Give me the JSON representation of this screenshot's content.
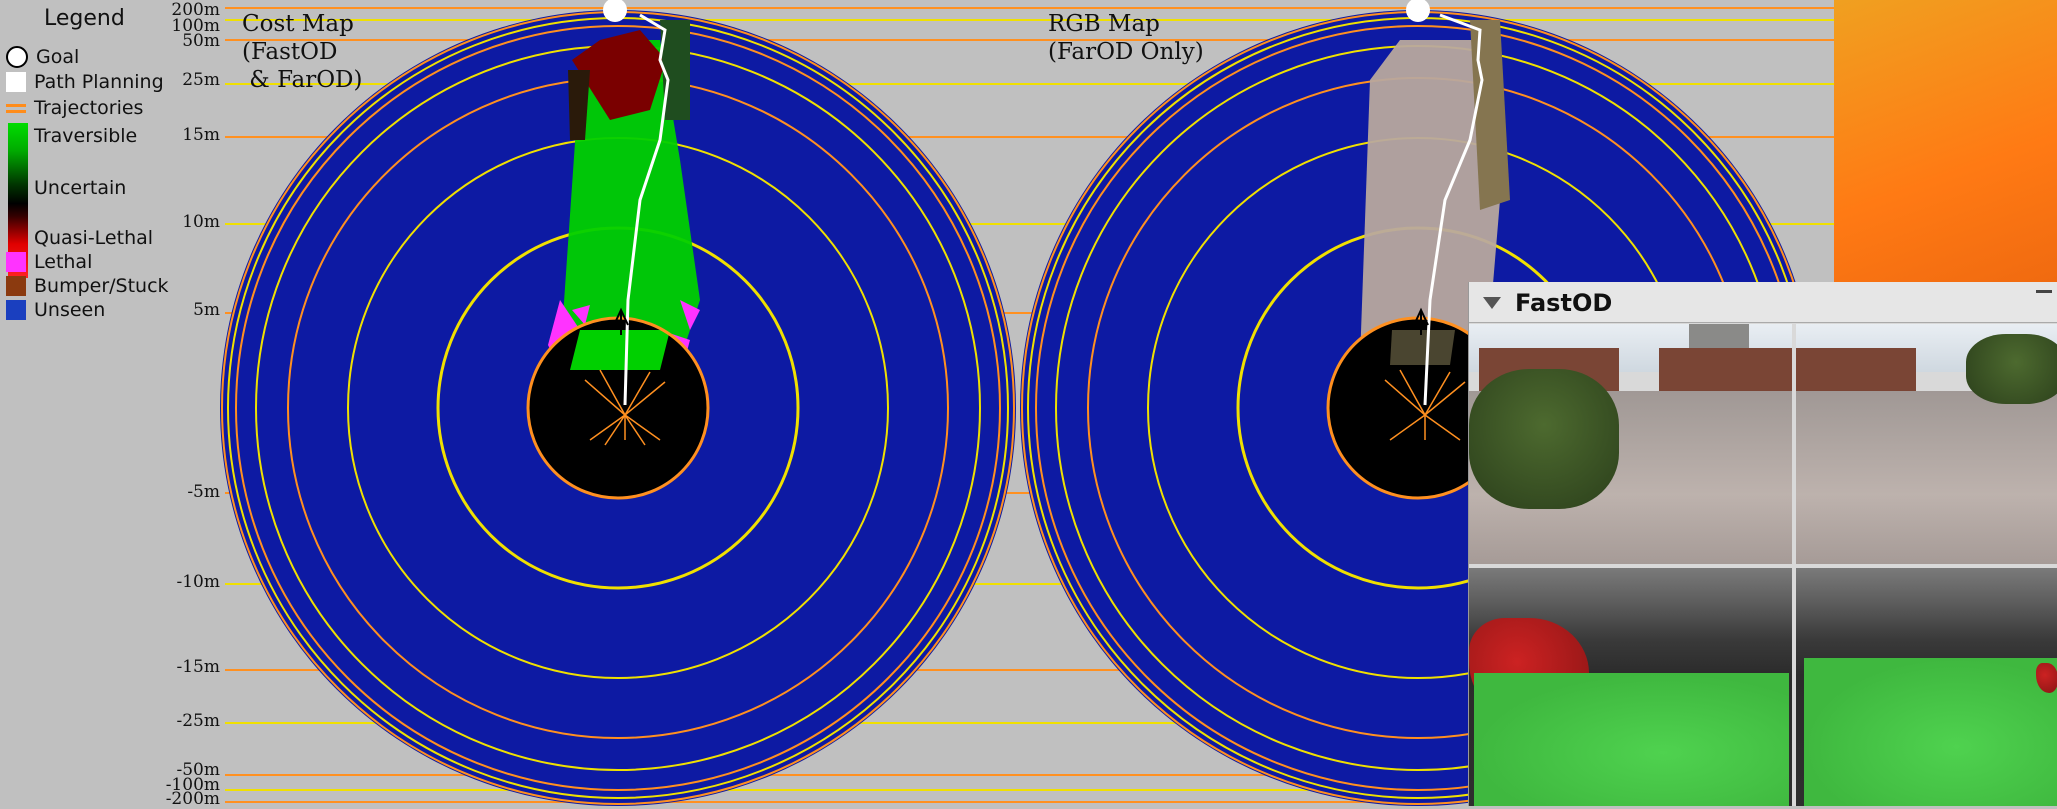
{
  "legend": {
    "title": "Legend",
    "items": [
      {
        "label": "Goal",
        "color": "#ffffff",
        "icon": "goal-circle-icon"
      },
      {
        "label": "Path Planning",
        "color": "#ffffff",
        "icon": "path-square-icon"
      },
      {
        "label": "Trajectories",
        "color": "#ff8c1a",
        "icon": "trajectory-lines-icon"
      },
      {
        "label": "Traversible",
        "color": "#00cc00"
      },
      {
        "label": "Uncertain",
        "color": "#000000"
      },
      {
        "label": "Quasi-Lethal",
        "color": "#ff0000"
      },
      {
        "label": "Lethal",
        "color": "#ff33ff"
      },
      {
        "label": "Bumper/Stuck",
        "color": "#8b3a0f"
      },
      {
        "label": "Unseen",
        "color": "#1a3fbf"
      }
    ]
  },
  "scale": {
    "top": [
      "200m",
      "100m",
      "50m",
      "25m",
      "15m",
      "10m",
      "5m"
    ],
    "bottom": [
      "-5m",
      "-10m",
      "-15m",
      "-25m",
      "-50m",
      "-100m",
      "-200m"
    ]
  },
  "maps": {
    "cost": {
      "title_line1": "Cost Map",
      "title_line2": "(FastOD",
      "title_line3": " & FarOD)"
    },
    "rgb": {
      "title_line1": "RGB Map",
      "title_line2": "(FarOD Only)"
    }
  },
  "panel": {
    "title": "FastOD",
    "collapse_icon": "triangle-down-icon"
  },
  "colors": {
    "background": "#c0c0c0",
    "unseen": "#0d1aa3",
    "ring_orange": "#ff9020",
    "ring_yellow": "#f0e000",
    "traversible": "#00cc00",
    "lethal": "#ff33ff"
  }
}
